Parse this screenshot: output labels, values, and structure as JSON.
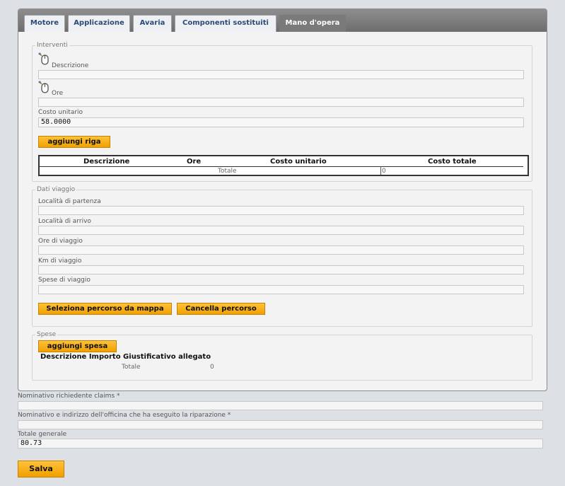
{
  "tabs": [
    {
      "label": "Motore"
    },
    {
      "label": "Applicazione"
    },
    {
      "label": "Avaria"
    },
    {
      "label": "Componenti sostituiti"
    },
    {
      "label": "Mano d'opera",
      "active": true
    }
  ],
  "interventi": {
    "legend": "Interventi",
    "descrizione_label": "Descrizione",
    "descrizione_value": "",
    "ore_label": "Ore",
    "ore_value": "",
    "costo_label": "Costo unitario",
    "costo_value": "58.0000",
    "add_row_label": "aggiungi riga",
    "table": {
      "headers": [
        "Descrizione",
        "Ore",
        "Costo unitario",
        "Costo totale"
      ],
      "total_label": "Totale",
      "total_value": "0"
    }
  },
  "viaggio": {
    "legend": "Dati viaggio",
    "partenza_label": "Località di partenza",
    "arrivo_label": "Località di arrivo",
    "ore_label": "Ore di viaggio",
    "km_label": "Km di viaggio",
    "spese_label": "Spese di viaggio",
    "select_route_label": "Seleziona percorso da mappa",
    "cancel_route_label": "Cancella percorso"
  },
  "spese": {
    "legend": "Spese",
    "add_label": "aggiungi spesa",
    "header": "Descrizione Importo Giustificativo allegato",
    "total_label": "Totale",
    "total_value": "0"
  },
  "footer": {
    "richiedente_label": "Nominativo richiedente claims *",
    "officina_label": "Nominativo e indirizzo dell'officina che ha eseguito la riparazione *",
    "totale_label": "Totale generale",
    "totale_value": "80.73",
    "save_label": "Salva"
  }
}
